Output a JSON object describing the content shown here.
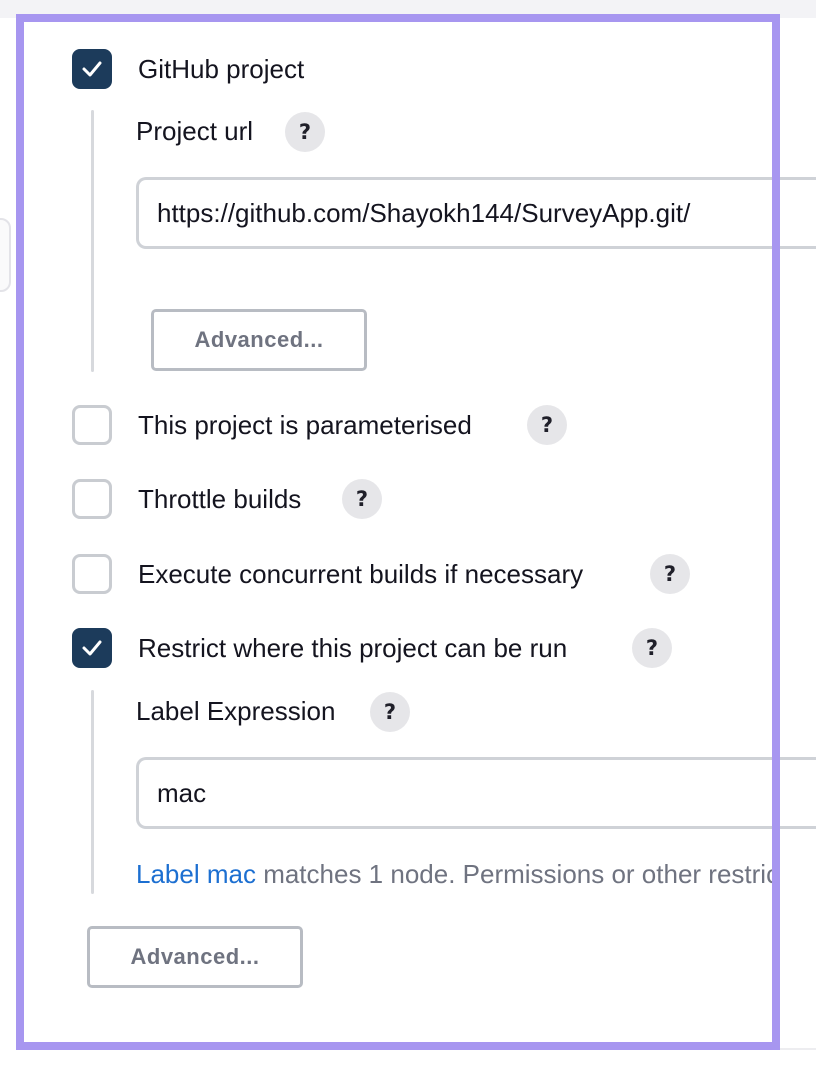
{
  "github": {
    "checked": true,
    "label": "GitHub project",
    "project_url": {
      "label": "Project url",
      "help": "?",
      "value": "https://github.com/Shayokh144/SurveyApp.git/"
    },
    "advanced_label": "Advanced..."
  },
  "options": [
    {
      "label": "This project is parameterised",
      "checked": false,
      "help": "?"
    },
    {
      "label": "Throttle builds",
      "checked": false,
      "help": "?"
    },
    {
      "label": "Execute concurrent builds if necessary",
      "checked": false,
      "help": "?"
    }
  ],
  "restrict": {
    "checked": true,
    "label": "Restrict where this project can be run",
    "help": "?",
    "label_expression": {
      "label": "Label Expression",
      "help": "?",
      "value": "mac"
    },
    "message": {
      "link": "Label mac",
      "text": " matches 1 node. Permissions or other restric"
    }
  },
  "advanced_label": "Advanced...",
  "colors": {
    "checkbox_checked": "#1c3b5b",
    "link": "#1c6fd1",
    "highlight_frame": "#a796f0"
  }
}
